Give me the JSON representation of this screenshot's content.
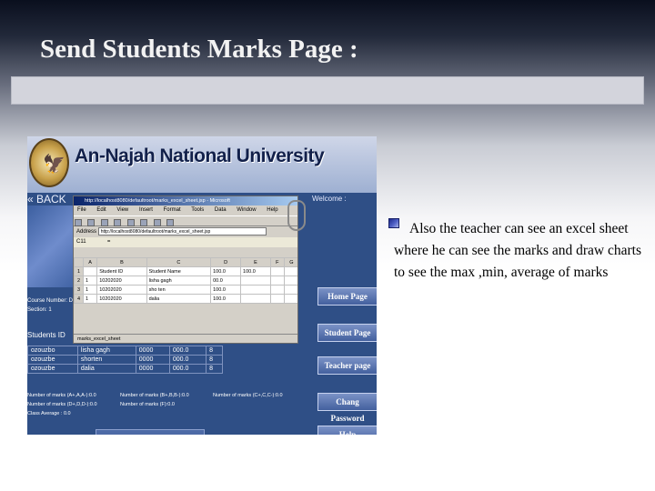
{
  "slide": {
    "title": "Send Students Marks Page :",
    "bullet": "Also the teacher can see an excel sheet where he can see the marks and draw charts to see the max ,min, average of marks"
  },
  "screenshot": {
    "university_name": "An-Najah National University",
    "back_label": "« BACK",
    "welcome_text": "Welcome :",
    "nav_buttons": [
      "Home Page",
      "Student Page",
      "Teacher page",
      "Chang Password",
      "Help"
    ],
    "course_info": [
      "Course Number: Digi",
      "Section:        1",
      "Students ID"
    ],
    "student_table": {
      "rows": [
        [
          "ozouzbo",
          "lisha gagh",
          "0000",
          "000.0",
          "8"
        ],
        [
          "ozouzbe",
          "shorten",
          "0000",
          "000.0",
          "8"
        ],
        [
          "ozouzbe",
          "dalia",
          "0000",
          "000.0",
          "8"
        ]
      ]
    },
    "stats": [
      "Number of marks (A+,A,A-):0.0",
      "Number of marks (B+,B,B-):0.0",
      "Number of marks (C+,C,C-):0.0",
      "Number of marks (D+,D,D-):0.0",
      "Number of marks (F):0.0",
      "Class Average : 0.0"
    ]
  },
  "excel": {
    "window_title": "http://localhost8080/defaultroot/marks_excel_sheet.jsp - Microsoft",
    "menu": [
      "File",
      "Edit",
      "View",
      "Insert",
      "Format",
      "Tools",
      "Data",
      "Window",
      "Help"
    ],
    "address_label": "Address",
    "address": "http://localhost8080/defaultroot/marks_excel_sheet.jsp",
    "cell_ref": "C11",
    "formula": "=",
    "columns": [
      "",
      "A",
      "B",
      "C",
      "D",
      "E",
      "F",
      "G"
    ],
    "header_row": [
      "1",
      "Student ID",
      "Student Name",
      "100.0",
      "100.0"
    ],
    "rows": [
      [
        "2",
        "1",
        "10202020",
        "lisha gagh",
        "00.0",
        ""
      ],
      [
        "3",
        "1",
        "10202020",
        "sho ten",
        "100.0",
        ""
      ],
      [
        "4",
        "1",
        "10202020",
        "dalia",
        "100.0",
        ""
      ]
    ],
    "sheet_tab": "marks_excel_sheet"
  }
}
